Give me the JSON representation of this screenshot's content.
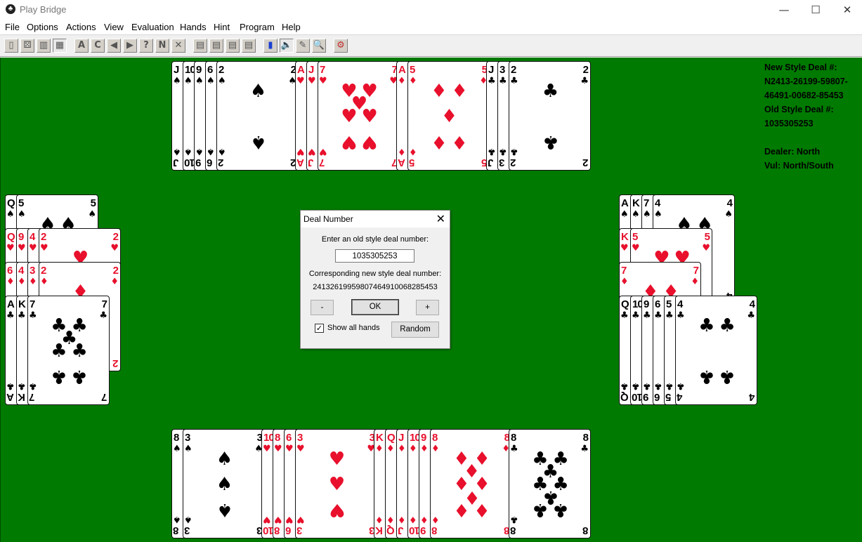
{
  "window": {
    "title": "Play Bridge",
    "icon": "bridge-app-icon",
    "minimize": "—",
    "maximize": "☐",
    "close": "✕"
  },
  "menu": [
    "File",
    "Options",
    "Actions",
    "View",
    "Evaluation",
    "Hands",
    "Hint",
    "Program",
    "Help"
  ],
  "toolbar": [
    {
      "name": "open-deck-icon",
      "glyph": "▯"
    },
    {
      "name": "random-deal-icon",
      "glyph": "⚄"
    },
    {
      "name": "display-icon",
      "glyph": "▥"
    },
    {
      "name": "deal-number-icon",
      "glyph": "▦"
    },
    {
      "name": "auction-a-icon",
      "glyph": "A"
    },
    {
      "name": "auction-c-icon",
      "glyph": "C"
    },
    {
      "name": "back-icon",
      "glyph": "◀"
    },
    {
      "name": "forward-icon",
      "glyph": "▶"
    },
    {
      "name": "hint-icon",
      "glyph": "?"
    },
    {
      "name": "n-icon",
      "glyph": "N"
    },
    {
      "name": "cancel-icon",
      "glyph": "✕"
    },
    {
      "name": "layout-1-icon",
      "glyph": "▤"
    },
    {
      "name": "layout-2-icon",
      "glyph": "▤"
    },
    {
      "name": "layout-3-icon",
      "glyph": "▤"
    },
    {
      "name": "layout-4-icon",
      "glyph": "▤"
    },
    {
      "name": "chart-icon",
      "glyph": "▮"
    },
    {
      "name": "sound-icon",
      "glyph": "🔈"
    },
    {
      "name": "edit-icon",
      "glyph": "✎"
    },
    {
      "name": "search-icon",
      "glyph": "🔍"
    },
    {
      "name": "settings-icon",
      "glyph": "⚙"
    }
  ],
  "dealinfo": {
    "new_label": "New Style Deal #:",
    "new_line1": "N2413-26199-59807-",
    "new_line2": "46491-00682-85453",
    "old_label": "Old Style Deal #:",
    "old_value": "1035305253",
    "dealer": "Dealer: North",
    "vul": "Vul: North/South"
  },
  "hands": {
    "north": {
      "spades": [
        "J",
        "10",
        "9",
        "6",
        "2"
      ],
      "hearts": [
        "A",
        "J",
        "7"
      ],
      "diamonds": [
        "A",
        "5"
      ],
      "clubs": [
        "J",
        "3",
        "2"
      ]
    },
    "west": {
      "spades": [
        "Q",
        "5"
      ],
      "hearts": [
        "Q",
        "9",
        "4",
        "2"
      ],
      "diamonds": [
        "6",
        "4",
        "3",
        "2"
      ],
      "clubs": [
        "A",
        "K",
        "7"
      ]
    },
    "east": {
      "spades": [
        "A",
        "K",
        "7",
        "4"
      ],
      "hearts": [
        "K",
        "5"
      ],
      "diamonds": [
        "7"
      ],
      "clubs": [
        "Q",
        "10",
        "9",
        "6",
        "5",
        "4"
      ]
    },
    "south": {
      "spades": [
        "8",
        "3"
      ],
      "hearts": [
        "10",
        "8",
        "6",
        "3"
      ],
      "diamonds": [
        "K",
        "Q",
        "J",
        "10",
        "9",
        "8"
      ],
      "clubs": [
        "8"
      ]
    }
  },
  "suits": {
    "spades": {
      "glyph": "♠",
      "color": "#000000"
    },
    "hearts": {
      "glyph": "♥",
      "color": "#e8102c"
    },
    "diamonds": {
      "glyph": "♦",
      "color": "#e8102c"
    },
    "clubs": {
      "glyph": "♣",
      "color": "#000000"
    }
  },
  "table_color": "#007a00",
  "dialog": {
    "title": "Deal Number",
    "prompt": "Enter an old style deal number:",
    "input_value": "1035305253",
    "corr_label": "Corresponding new style deal number:",
    "corr_value": "2413261995980746491006828545З",
    "minus": "-",
    "ok": "OK",
    "plus": "+",
    "show_all": "Show all hands",
    "show_all_checked": true,
    "random": "Random"
  }
}
